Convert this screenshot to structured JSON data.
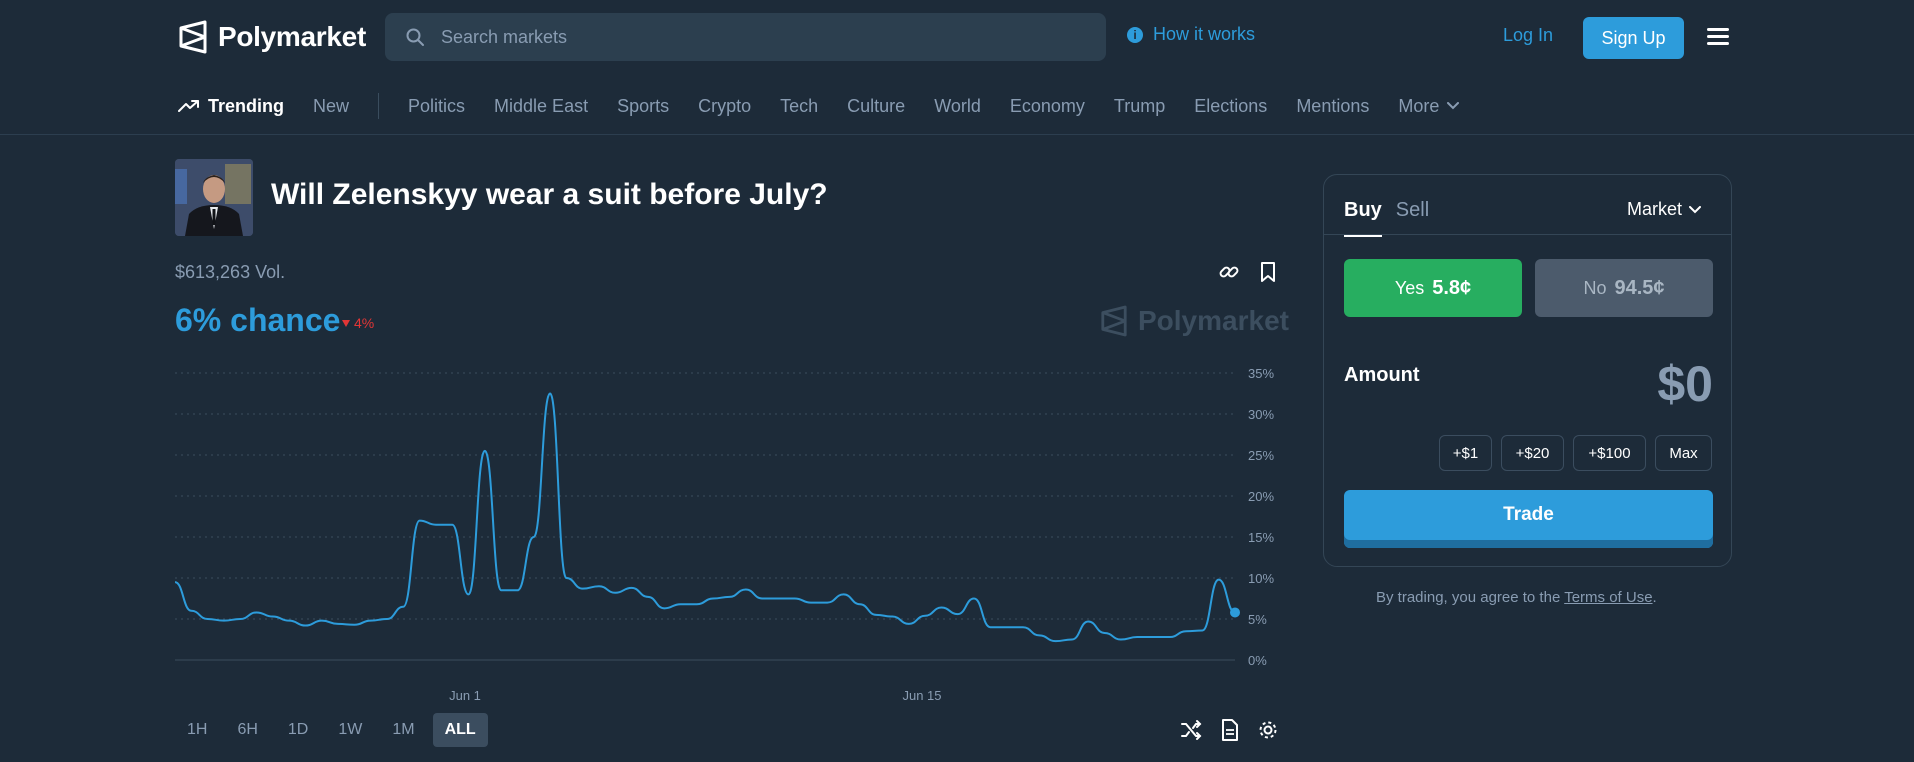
{
  "header": {
    "brand": "Polymarket",
    "search_placeholder": "Search markets",
    "how_it_works": "How it works",
    "login": "Log In",
    "signup": "Sign Up"
  },
  "nav": {
    "trending": "Trending",
    "new": "New",
    "categories": [
      "Politics",
      "Middle East",
      "Sports",
      "Crypto",
      "Tech",
      "Culture",
      "World",
      "Economy",
      "Trump",
      "Elections",
      "Mentions"
    ],
    "more": "More"
  },
  "market": {
    "title": "Will Zelenskyy wear a suit before July?",
    "volume": "$613,263 Vol.",
    "chance": "6% chance",
    "change": "4%",
    "watermark": "Polymarket"
  },
  "chart_data": {
    "type": "line",
    "title": "",
    "xlabel": "",
    "ylabel": "",
    "ylim": [
      0,
      35
    ],
    "y_ticks": [
      "35%",
      "30%",
      "25%",
      "20%",
      "15%",
      "10%",
      "5%",
      "0%"
    ],
    "x_ticks": [
      "Jun 1",
      "Jun 15"
    ],
    "color": "#2d9cdb",
    "grid": true,
    "series": [
      {
        "values": [
          9.5,
          6,
          5,
          4.8,
          5,
          5.8,
          5.3,
          4.8,
          4.2,
          4.8,
          4.4,
          4.3,
          4.8,
          5,
          6.5,
          17,
          16.5,
          16.5,
          8,
          25.5,
          8.5,
          8.5,
          15,
          32.5,
          10,
          8.7,
          9,
          8.2,
          8.8,
          7.7,
          6.3,
          6.8,
          6.8,
          7.5,
          7.7,
          8.6,
          7.5,
          7.5,
          7.5,
          7,
          7,
          8,
          6.8,
          5.5,
          5.3,
          4.4,
          5.4,
          6.4,
          5.6,
          7.5,
          4,
          4,
          4,
          3,
          2.3,
          2.5,
          4.7,
          3.3,
          2.5,
          2.8,
          2.8,
          2.8,
          3.5,
          3.6,
          9.8,
          5.8
        ]
      }
    ]
  },
  "time_ranges": [
    "1H",
    "6H",
    "1D",
    "1W",
    "1M",
    "ALL"
  ],
  "trade": {
    "buy": "Buy",
    "sell": "Sell",
    "order_type": "Market",
    "yes_label": "Yes",
    "yes_price": "5.8¢",
    "no_label": "No",
    "no_price": "94.5¢",
    "amount_label": "Amount",
    "amount_value": "$0",
    "quick_amounts": [
      "+$1",
      "+$20",
      "+$100",
      "Max"
    ],
    "trade_button": "Trade",
    "terms_prefix": "By trading, you agree to the ",
    "terms_link": "Terms of Use",
    "terms_suffix": "."
  }
}
